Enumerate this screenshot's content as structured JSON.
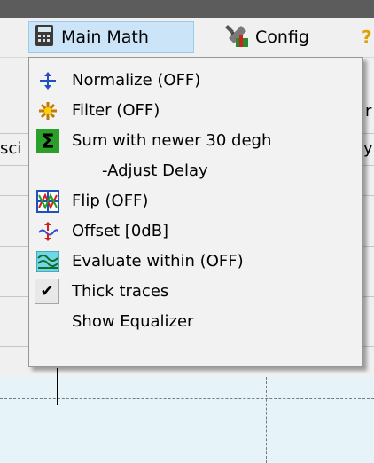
{
  "menubar": {
    "main_math_label": "Main Math",
    "config_label": "Config",
    "extra_label": "?"
  },
  "background": {
    "left_fragment": "sci",
    "right_fragment_1": "r",
    "right_fragment_2": "y("
  },
  "popup_menu": {
    "items": [
      {
        "label": "Normalize (OFF)",
        "icon": "normalize-icon"
      },
      {
        "label": "Filter (OFF)",
        "icon": "filter-icon"
      },
      {
        "label": "Sum with  newer 30 degh",
        "icon": "sum-icon"
      },
      {
        "label": "-Adjust Delay",
        "icon": ""
      },
      {
        "label": "Flip (OFF)",
        "icon": "flip-icon"
      },
      {
        "label": "Offset [0dB]",
        "icon": "offset-icon"
      },
      {
        "label": "Evaluate within (OFF)",
        "icon": "evaluate-icon"
      },
      {
        "label": "Thick traces",
        "icon": "checkmark-icon",
        "checked": true
      },
      {
        "label": "Show Equalizer",
        "icon": ""
      }
    ]
  },
  "colors": {
    "menubar_highlight": "#cce4f7",
    "sum_icon_green": "#2aa02a",
    "offset_icon_red": "#d0202a",
    "offset_icon_blue": "#2a50d0"
  }
}
